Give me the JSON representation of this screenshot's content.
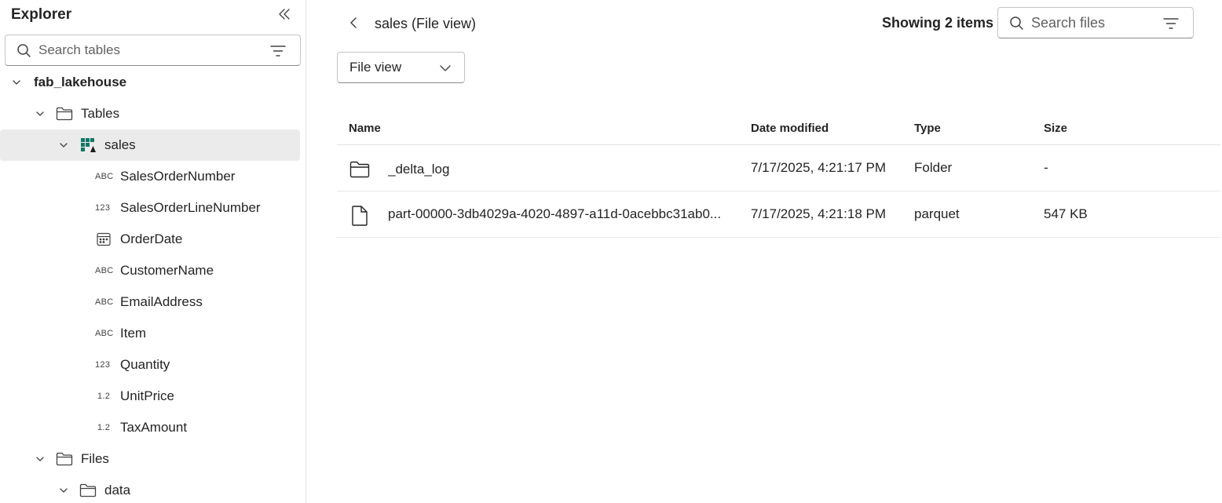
{
  "sidebar": {
    "title": "Explorer",
    "search_placeholder": "Search tables",
    "lakehouse": "fab_lakehouse",
    "tables_folder": "Tables",
    "table_name": "sales",
    "columns": [
      {
        "type": "ABC",
        "name": "SalesOrderNumber"
      },
      {
        "type": "123",
        "name": "SalesOrderLineNumber"
      },
      {
        "type": "calendar",
        "name": "OrderDate"
      },
      {
        "type": "ABC",
        "name": "CustomerName"
      },
      {
        "type": "ABC",
        "name": "EmailAddress"
      },
      {
        "type": "ABC",
        "name": "Item"
      },
      {
        "type": "123",
        "name": "Quantity"
      },
      {
        "type": "1.2",
        "name": "UnitPrice"
      },
      {
        "type": "1.2",
        "name": "TaxAmount"
      }
    ],
    "files_folder": "Files",
    "data_folder": "data"
  },
  "main": {
    "breadcrumb": "sales (File view)",
    "showing": "Showing 2 items",
    "search_placeholder": "Search files",
    "view_dropdown": "File view",
    "columns": {
      "name": "Name",
      "date": "Date modified",
      "type": "Type",
      "size": "Size"
    },
    "rows": [
      {
        "icon": "folder-icon",
        "name": "_delta_log",
        "date": "7/17/2025, 4:21:17 PM",
        "type": "Folder",
        "size": "-"
      },
      {
        "icon": "file-icon",
        "name": "part-00000-3db4029a-4020-4897-a11d-0acebbc31ab0...",
        "date": "7/17/2025, 4:21:18 PM",
        "type": "parquet",
        "size": "547 KB"
      }
    ]
  },
  "colors": {
    "text": "#242424",
    "selected_row": "#ebebeb",
    "border": "#e0e0e0",
    "table_icon": "#117865"
  }
}
